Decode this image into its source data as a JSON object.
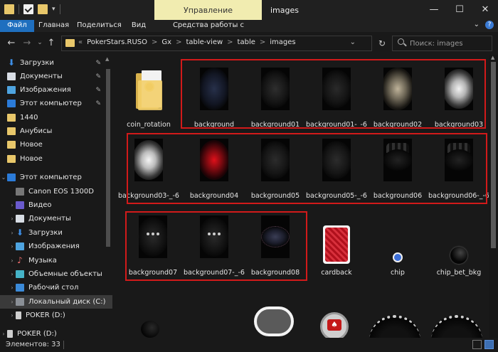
{
  "window": {
    "manage_tab": "Управление",
    "title": "images",
    "min_symbol": "—",
    "max_symbol": "☐",
    "close_symbol": "✕"
  },
  "ribbon": {
    "tabs": [
      "Файл",
      "Главная",
      "Поделиться",
      "Вид",
      "Средства работы с рисунками"
    ],
    "help_symbol": "?"
  },
  "address": {
    "prefix": "«",
    "crumbs": [
      "PokerStars.RUSO",
      "Gx",
      "table-view",
      "table",
      "images"
    ],
    "separator": ">",
    "search_placeholder": "Поиск: images"
  },
  "sidebar": {
    "items": [
      {
        "label": "Загрузки",
        "icon": "download-icon",
        "pinned": true
      },
      {
        "label": "Документы",
        "icon": "documents-icon",
        "pinned": true
      },
      {
        "label": "Изображения",
        "icon": "images-icon",
        "pinned": true
      },
      {
        "label": "Этот компьютер",
        "icon": "computer-icon",
        "pinned": true
      },
      {
        "label": "1440",
        "icon": "folder-icon",
        "pinned": false
      },
      {
        "label": "Анубисы",
        "icon": "folder-icon",
        "pinned": false
      },
      {
        "label": "Новое",
        "icon": "folder-icon",
        "pinned": false
      },
      {
        "label": "Новое",
        "icon": "folder-icon",
        "pinned": false
      },
      {
        "label": "Этот компьютер",
        "icon": "computer-icon",
        "pinned": false
      },
      {
        "label": "Canon EOS 1300D",
        "icon": "camera-icon",
        "pinned": false
      },
      {
        "label": "Видео",
        "icon": "video-icon",
        "pinned": false
      },
      {
        "label": "Документы",
        "icon": "documents-icon",
        "pinned": false
      },
      {
        "label": "Загрузки",
        "icon": "download-icon",
        "pinned": false
      },
      {
        "label": "Изображения",
        "icon": "images-icon",
        "pinned": false
      },
      {
        "label": "Музыка",
        "icon": "music-icon",
        "pinned": false
      },
      {
        "label": "Объемные объекты",
        "icon": "3d-objects-icon",
        "pinned": false
      },
      {
        "label": "Рабочий стол",
        "icon": "desktop-icon",
        "pinned": false
      },
      {
        "label": "Локальный диск (C:)",
        "icon": "disk-icon",
        "pinned": false
      },
      {
        "label": "POKER (D:)",
        "icon": "usb-drive-icon",
        "pinned": false
      },
      {
        "label": "POKER (D:)",
        "icon": "usb-drive-icon",
        "pinned": false
      }
    ]
  },
  "files": [
    {
      "name": "coin_rotation",
      "kind": "folder"
    },
    {
      "name": "background",
      "kind": "dark-blue"
    },
    {
      "name": "background01",
      "kind": "dark-glow"
    },
    {
      "name": "background01-_-6",
      "kind": "dark-glow"
    },
    {
      "name": "background02",
      "kind": "beige-glow"
    },
    {
      "name": "background03",
      "kind": "white-glow"
    },
    {
      "name": "background03-_-6",
      "kind": "white-glow"
    },
    {
      "name": "background04",
      "kind": "red-glow"
    },
    {
      "name": "background05",
      "kind": "dark-glow"
    },
    {
      "name": "background05-_-6",
      "kind": "dark-glow"
    },
    {
      "name": "background06",
      "kind": "dark-top"
    },
    {
      "name": "background06-_-6",
      "kind": "dark-top"
    },
    {
      "name": "background07",
      "kind": "dots"
    },
    {
      "name": "background07-_-6",
      "kind": "dots"
    },
    {
      "name": "background08",
      "kind": "oval-glow"
    },
    {
      "name": "cardback",
      "kind": "cardback"
    },
    {
      "name": "chip",
      "kind": "chip"
    },
    {
      "name": "chip_bet_bkg",
      "kind": "black-ball"
    }
  ],
  "status": {
    "items_count": "Элементов: 33"
  }
}
